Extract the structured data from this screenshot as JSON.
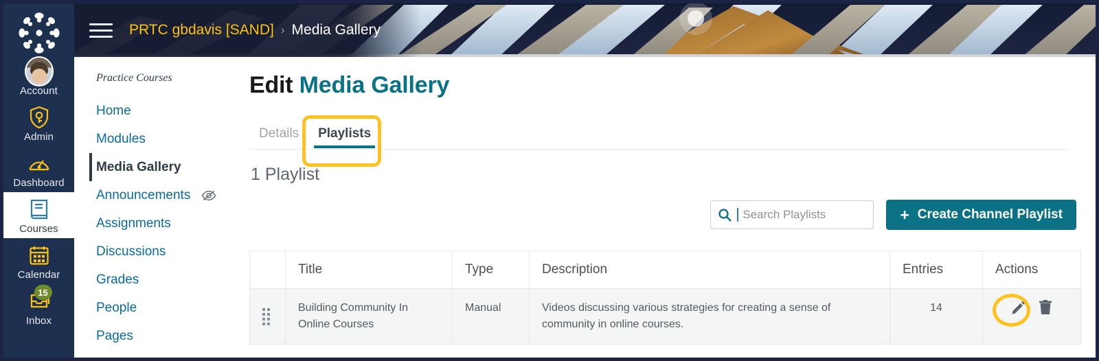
{
  "global_nav": {
    "logo_name": "canvas-logo",
    "items": [
      {
        "label": "Account",
        "icon": "avatar-icon",
        "badge": null
      },
      {
        "label": "Admin",
        "icon": "shield-key-icon",
        "badge": null
      },
      {
        "label": "Dashboard",
        "icon": "speedometer-icon",
        "badge": null
      },
      {
        "label": "Courses",
        "icon": "book-icon",
        "badge": null,
        "active": true
      },
      {
        "label": "Calendar",
        "icon": "calendar-icon",
        "badge": null
      },
      {
        "label": "Inbox",
        "icon": "inbox-icon",
        "badge": "15"
      }
    ]
  },
  "header": {
    "menu_icon": "hamburger-icon",
    "breadcrumb": {
      "course": "PRTC gbdavis [SAND]",
      "separator": "›",
      "current": "Media Gallery"
    }
  },
  "course_nav": {
    "heading": "Practice Courses",
    "items": [
      {
        "label": "Home",
        "active": false,
        "hidden_icon": false
      },
      {
        "label": "Modules",
        "active": false,
        "hidden_icon": false
      },
      {
        "label": "Media Gallery",
        "active": true,
        "hidden_icon": false
      },
      {
        "label": "Announcements",
        "active": false,
        "hidden_icon": true
      },
      {
        "label": "Assignments",
        "active": false,
        "hidden_icon": false
      },
      {
        "label": "Discussions",
        "active": false,
        "hidden_icon": false
      },
      {
        "label": "Grades",
        "active": false,
        "hidden_icon": false
      },
      {
        "label": "People",
        "active": false,
        "hidden_icon": false
      },
      {
        "label": "Pages",
        "active": false,
        "hidden_icon": false
      }
    ]
  },
  "main": {
    "title_prefix": "Edit",
    "title_accent": "Media Gallery",
    "tabs": [
      {
        "label": "Details",
        "selected": false
      },
      {
        "label": "Playlists",
        "selected": true
      }
    ],
    "count_text": "1 Playlist",
    "search": {
      "placeholder": "Search Playlists",
      "value": "",
      "icon": "search-icon"
    },
    "create_button": {
      "label": "Create Channel Playlist",
      "plus": "+"
    },
    "table": {
      "columns": [
        "",
        "Title",
        "Type",
        "Description",
        "Entries",
        "Actions"
      ],
      "rows": [
        {
          "handle": "drag-handle-icon",
          "title": "Building Community In Online Courses",
          "type": "Manual",
          "description": "Videos discussing various strategies for creating a sense of community in online courses.",
          "entries": "14",
          "actions": [
            "edit-icon",
            "delete-icon"
          ]
        }
      ]
    }
  },
  "annotations": {
    "tab_highlight": "playlists-tab-highlight",
    "edit_highlight": "edit-action-highlight",
    "color": "#ffc222"
  },
  "colors": {
    "nav_navy": "#1e3050",
    "accent_teal": "#0a7285",
    "link_blue": "#0a6a9e",
    "breadcrumb_gold": "#ffc20e",
    "badge_green": "#6e8c2c",
    "highlight_yellow": "#ffc222"
  }
}
